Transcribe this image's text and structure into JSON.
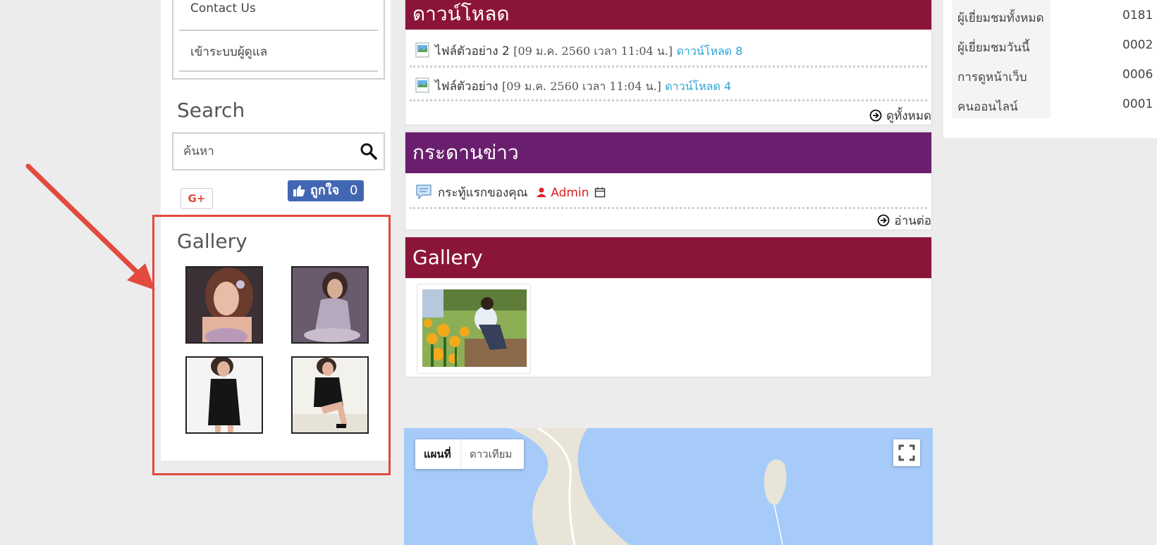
{
  "sidebar": {
    "menu": [
      "Contact Us",
      "เข้าระบบผู้ดูแล"
    ],
    "search": {
      "title": "Search",
      "placeholder": "ค้นหา"
    },
    "social": {
      "gplus_label": "G+",
      "like_label": "ถูกใจ",
      "like_count": "0"
    },
    "gallery": {
      "title": "Gallery"
    }
  },
  "downloads": {
    "title": "ดาวน์โหลด",
    "items": [
      {
        "name": "ไฟล์ตัวอย่าง 2",
        "date": "[09 ม.ค. 2560 เวลา 11:04 น.]",
        "count": "ดาวน์โหลด 8"
      },
      {
        "name": "ไฟล์ตัวอย่าง",
        "date": "[09 ม.ค. 2560 เวลา 11:04 น.]",
        "count": "ดาวน์โหลด 4"
      }
    ],
    "more": "ดูทั้งหมด"
  },
  "board": {
    "title": "กระดานข่าว",
    "topic": "กระทู้แรกของคุณ",
    "author": "Admin",
    "more": "อ่านต่อ"
  },
  "gallery_panel": {
    "title": "Gallery"
  },
  "map": {
    "btn_map": "แผนที่",
    "btn_satellite": "ดาวเทียม"
  },
  "stats": [
    {
      "label": "ผู้เยี่ยมชมทั้งหมด",
      "value": "0181"
    },
    {
      "label": "ผู้เยี่ยมชมวันนี้",
      "value": "0002"
    },
    {
      "label": "การดูหน้าเว็บ",
      "value": "0006"
    },
    {
      "label": "คนออนไลน์",
      "value": "0001"
    }
  ],
  "colors": {
    "downloads_header": "#8b1538",
    "board_header": "#6a1f6e",
    "gallery_header": "#8b1538",
    "link_blue": "#2aa4d6",
    "author_red": "#e02020",
    "highlight_red": "#e14a3d",
    "fb_blue": "#4267b2"
  }
}
